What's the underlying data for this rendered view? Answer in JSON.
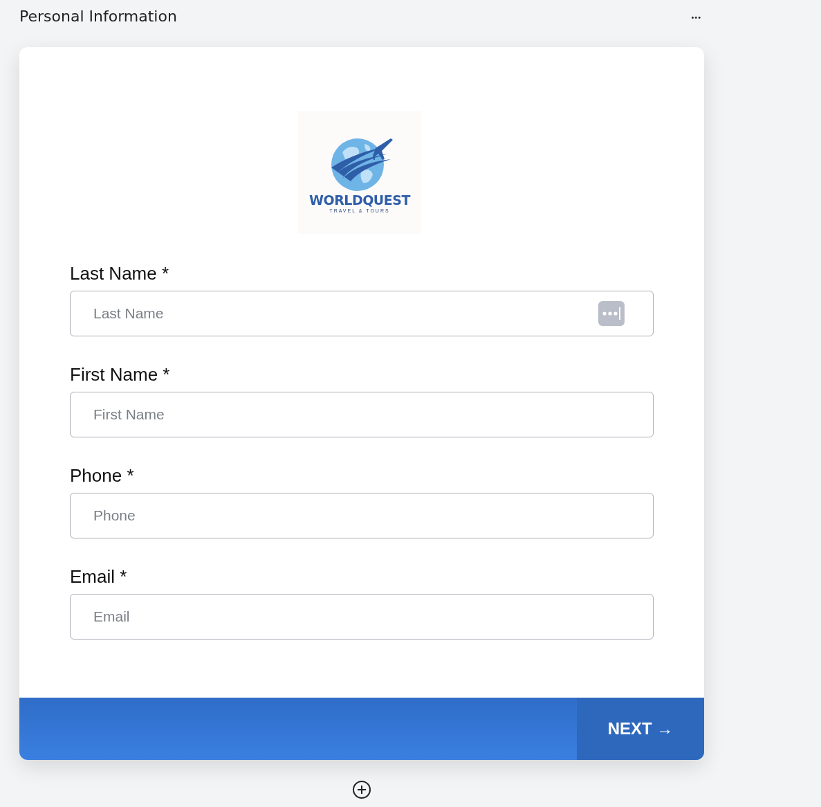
{
  "header": {
    "title": "Personal Information",
    "menu": "•••"
  },
  "logo": {
    "name": "WORLDQUEST",
    "tagline": "TRAVEL & TOURS"
  },
  "fields": [
    {
      "label": "Last Name",
      "required": "*",
      "placeholder": "Last Name",
      "autofill_icon": true
    },
    {
      "label": "First Name",
      "required": "*",
      "placeholder": "First Name",
      "autofill_icon": false
    },
    {
      "label": "Phone",
      "required": "*",
      "placeholder": "Phone",
      "autofill_icon": false
    },
    {
      "label": "Email",
      "required": "*",
      "placeholder": "Email",
      "autofill_icon": false
    }
  ],
  "next_button": {
    "label": "NEXT →"
  }
}
